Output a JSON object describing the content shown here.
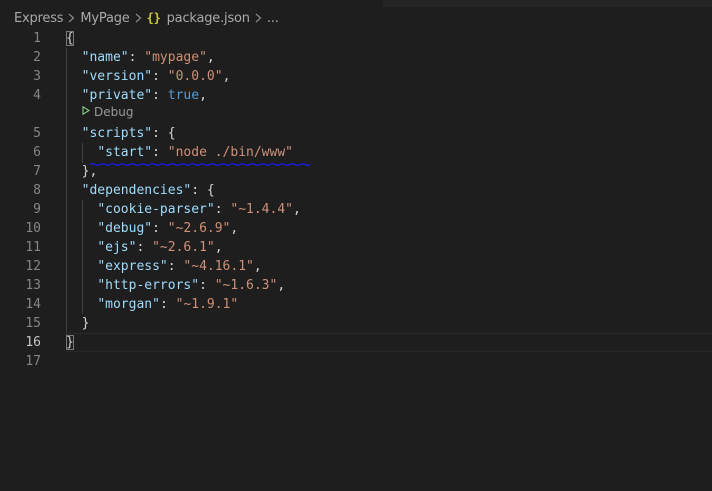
{
  "breadcrumb": {
    "items": [
      "Express",
      "MyPage"
    ],
    "file_icon": "{}",
    "file_name": "package.json",
    "more": "..."
  },
  "codelens": {
    "label": "Debug",
    "icon": "play-icon"
  },
  "editor": {
    "active_line": 16,
    "lines": [
      {
        "n": "1",
        "tokens": [
          {
            "t": "p",
            "v": "{"
          }
        ]
      },
      {
        "n": "2",
        "tokens": [
          {
            "t": "p",
            "v": "  "
          },
          {
            "t": "k",
            "v": "\"name\""
          },
          {
            "t": "p",
            "v": ": "
          },
          {
            "t": "s",
            "v": "\"mypage\""
          },
          {
            "t": "p",
            "v": ","
          }
        ]
      },
      {
        "n": "3",
        "tokens": [
          {
            "t": "p",
            "v": "  "
          },
          {
            "t": "k",
            "v": "\"version\""
          },
          {
            "t": "p",
            "v": ": "
          },
          {
            "t": "s",
            "v": "\"0.0.0\""
          },
          {
            "t": "p",
            "v": ","
          }
        ]
      },
      {
        "n": "4",
        "tokens": [
          {
            "t": "p",
            "v": "  "
          },
          {
            "t": "k",
            "v": "\"private\""
          },
          {
            "t": "p",
            "v": ": "
          },
          {
            "t": "b",
            "v": "true"
          },
          {
            "t": "p",
            "v": ","
          }
        ]
      },
      {
        "n": "5",
        "tokens": [
          {
            "t": "p",
            "v": "  "
          },
          {
            "t": "k",
            "v": "\"scripts\""
          },
          {
            "t": "p",
            "v": ": {"
          }
        ]
      },
      {
        "n": "6",
        "tokens": [
          {
            "t": "p",
            "v": "    "
          },
          {
            "t": "k",
            "v": "\"start\""
          },
          {
            "t": "p",
            "v": ": "
          },
          {
            "t": "s",
            "v": "\"node ./bin/www\""
          }
        ]
      },
      {
        "n": "7",
        "tokens": [
          {
            "t": "p",
            "v": "  },"
          }
        ]
      },
      {
        "n": "8",
        "tokens": [
          {
            "t": "p",
            "v": "  "
          },
          {
            "t": "k",
            "v": "\"dependencies\""
          },
          {
            "t": "p",
            "v": ": {"
          }
        ]
      },
      {
        "n": "9",
        "tokens": [
          {
            "t": "p",
            "v": "    "
          },
          {
            "t": "k",
            "v": "\"cookie-parser\""
          },
          {
            "t": "p",
            "v": ": "
          },
          {
            "t": "s",
            "v": "\"~1.4.4\""
          },
          {
            "t": "p",
            "v": ","
          }
        ]
      },
      {
        "n": "10",
        "tokens": [
          {
            "t": "p",
            "v": "    "
          },
          {
            "t": "k",
            "v": "\"debug\""
          },
          {
            "t": "p",
            "v": ": "
          },
          {
            "t": "s",
            "v": "\"~2.6.9\""
          },
          {
            "t": "p",
            "v": ","
          }
        ]
      },
      {
        "n": "11",
        "tokens": [
          {
            "t": "p",
            "v": "    "
          },
          {
            "t": "k",
            "v": "\"ejs\""
          },
          {
            "t": "p",
            "v": ": "
          },
          {
            "t": "s",
            "v": "\"~2.6.1\""
          },
          {
            "t": "p",
            "v": ","
          }
        ]
      },
      {
        "n": "12",
        "tokens": [
          {
            "t": "p",
            "v": "    "
          },
          {
            "t": "k",
            "v": "\"express\""
          },
          {
            "t": "p",
            "v": ": "
          },
          {
            "t": "s",
            "v": "\"~4.16.1\""
          },
          {
            "t": "p",
            "v": ","
          }
        ]
      },
      {
        "n": "13",
        "tokens": [
          {
            "t": "p",
            "v": "    "
          },
          {
            "t": "k",
            "v": "\"http-errors\""
          },
          {
            "t": "p",
            "v": ": "
          },
          {
            "t": "s",
            "v": "\"~1.6.3\""
          },
          {
            "t": "p",
            "v": ","
          }
        ]
      },
      {
        "n": "14",
        "tokens": [
          {
            "t": "p",
            "v": "    "
          },
          {
            "t": "k",
            "v": "\"morgan\""
          },
          {
            "t": "p",
            "v": ": "
          },
          {
            "t": "s",
            "v": "\"~1.9.1\""
          }
        ]
      },
      {
        "n": "15",
        "tokens": [
          {
            "t": "p",
            "v": "  }"
          }
        ]
      },
      {
        "n": "16",
        "tokens": [
          {
            "t": "p",
            "v": "}"
          }
        ]
      },
      {
        "n": "17",
        "tokens": []
      }
    ]
  },
  "colors": {
    "background": "#1e1e1e",
    "key": "#9cdcfe",
    "string": "#ce9178",
    "boolean": "#569cd6",
    "line_number": "#858585",
    "squiggle": "#1a1aff"
  }
}
